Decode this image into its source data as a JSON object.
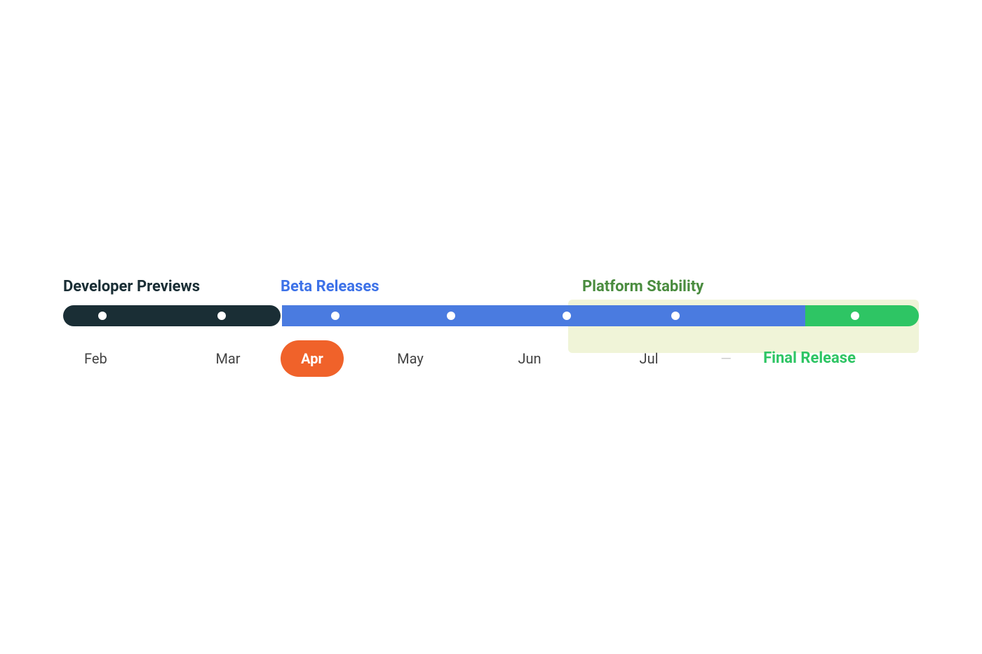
{
  "phases": {
    "developer_previews": {
      "label": "Developer Previews",
      "color": "#1a2e35"
    },
    "beta_releases": {
      "label": "Beta Releases",
      "color": "#3d72e8"
    },
    "platform_stability": {
      "label": "Platform Stability",
      "color": "#4a8c3f"
    }
  },
  "months": {
    "feb": "Feb",
    "mar": "Mar",
    "apr": "Apr",
    "may": "May",
    "jun": "Jun",
    "jul": "Jul",
    "final": "Final Release"
  },
  "colors": {
    "dev_track": "#1a2e35",
    "beta_track": "#4a7be0",
    "final_track": "#2ec564",
    "stability_bg": "#f0f4d8",
    "apr_badge": "#f0622a",
    "dot_color": "#ffffff",
    "final_label": "#2ec564"
  }
}
